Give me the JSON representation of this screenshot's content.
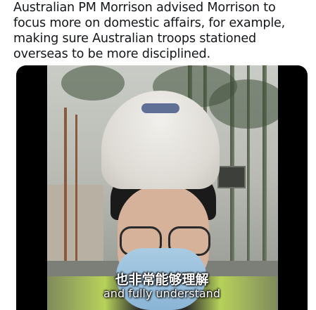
{
  "tweet": {
    "text": "Australian PM Morrison advised Morrison to focus more on domestic affairs, for example, making sure Australian troops stationed overseas to be more disciplined."
  },
  "video": {
    "subtitle_zh": "也非常能够理解",
    "subtitle_en": "and fully understand"
  }
}
